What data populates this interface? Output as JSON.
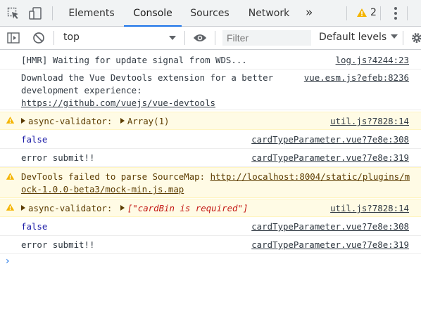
{
  "tabs": [
    "Elements",
    "Console",
    "Sources",
    "Network"
  ],
  "warning_count": "2",
  "toolbar": {
    "context": "top",
    "filter_placeholder": "Filter",
    "levels": "Default levels"
  },
  "icons": [
    "inspect-icon",
    "device-toggle-icon",
    "sidebar-toggle-icon",
    "clear-console-icon",
    "eye-icon",
    "gear-icon",
    "overflow-chevron-icon",
    "warning-icon",
    "more-menu-icon"
  ],
  "colors": {
    "accent": "#1a73e8",
    "warning_bg": "#fffbe5",
    "warning_text": "#5c3c00",
    "keyword_blue": "#1a1aa6",
    "string_red": "#c41a16"
  },
  "console": {
    "rows": [
      {
        "text": "[HMR] Waiting for update signal from WDS...",
        "source": "log.js?4244:23"
      },
      {
        "text": "Download the Vue Devtools extension for a better development experience:",
        "link": "https://github.com/vuejs/vue-devtools",
        "source": "vue.esm.js?efeb:8236"
      },
      {
        "prefix": "async-validator: ",
        "value": "Array(1)",
        "source": "util.js?7828:14"
      },
      {
        "text": "false",
        "source": "cardTypeParameter.vue?7e8e:308"
      },
      {
        "text": "error submit!!",
        "source": "cardTypeParameter.vue?7e8e:319"
      },
      {
        "text": "DevTools failed to parse SourceMap: ",
        "link": "http://localhost:8004/static/plugins/mock-1.0.0-beta3/mock-min.js.map"
      },
      {
        "prefix": "async-validator: ",
        "value": "[\"cardBin is required\"]",
        "source": "util.js?7828:14"
      },
      {
        "text": "false",
        "source": "cardTypeParameter.vue?7e8e:308"
      },
      {
        "text": "error submit!!",
        "source": "cardTypeParameter.vue?7e8e:319"
      }
    ],
    "prompt": "›"
  }
}
